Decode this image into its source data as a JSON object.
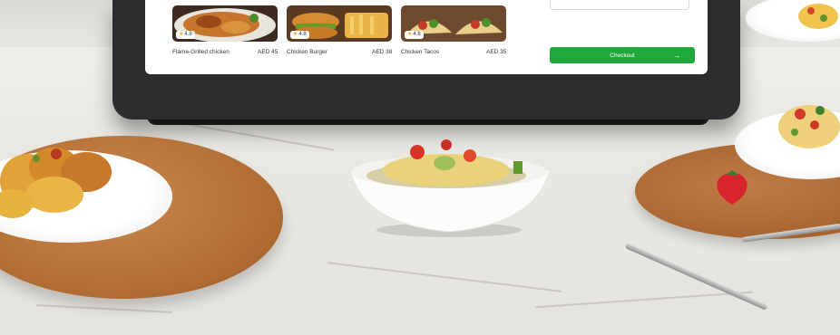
{
  "menu": {
    "items": [
      {
        "name": "Flame-Grilled chicken",
        "price": "AED 45",
        "rating": "4.8"
      },
      {
        "name": "Chicken Burger",
        "price": "AED 38",
        "rating": "4.8"
      },
      {
        "name": "Chicken Tacos",
        "price": "AED 35",
        "rating": "4.8"
      }
    ],
    "checkout_label": "Checkout",
    "checkout_arrow": "→",
    "star": "★"
  },
  "colors": {
    "accent": "#1fa83b",
    "tablet_bezel": "#2b2d2f",
    "wood": "#b9763f",
    "marble": "#ecebe7"
  }
}
